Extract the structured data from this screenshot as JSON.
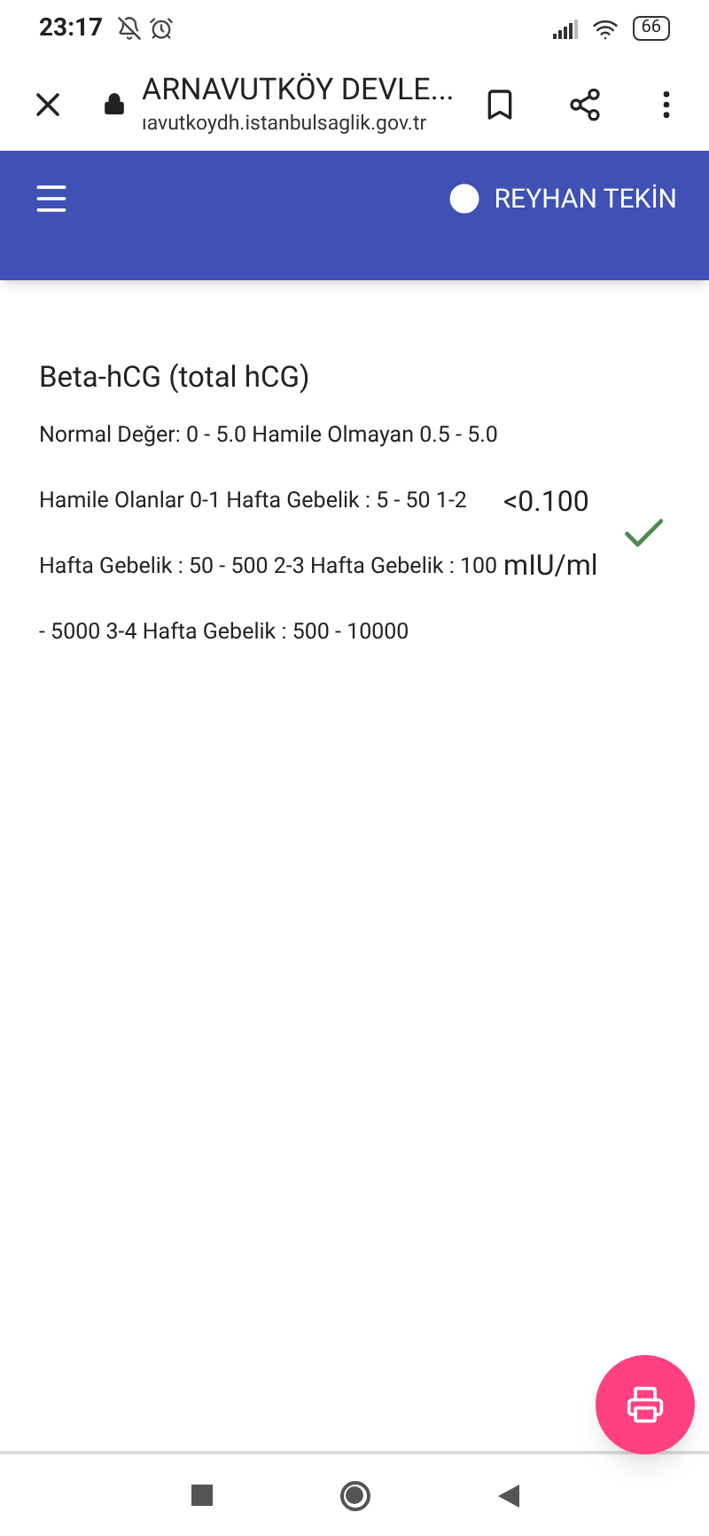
{
  "status_bar": {
    "time": "23:17",
    "battery": "66"
  },
  "browser": {
    "title": "ARNAVUTKÖY DEVLE...",
    "url": "ıavutkoydh.istanbulsaglik.gov.tr"
  },
  "header": {
    "user": "REYHAN TEKİN"
  },
  "test": {
    "name": "Beta-hCG (total hCG)",
    "reference": "Normal Değer: 0 - 5.0 Hamile Olmayan 0.5 - 5.0 Hamile Olanlar 0-1 Hafta Gebelik : 5 - 50 1-2 Hafta Gebelik : 50 - 500 2-3 Hafta Gebelik : 100 - 5000 3-4 Hafta Gebelik : 500 - 10000",
    "value": "<0.100",
    "unit": "mIU/ml"
  }
}
